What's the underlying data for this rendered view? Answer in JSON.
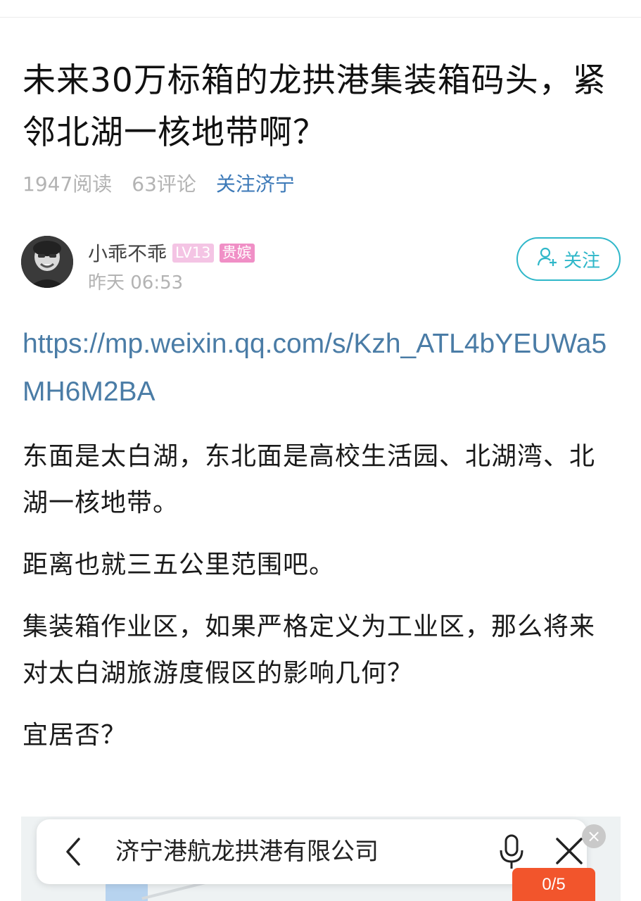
{
  "post": {
    "title": "未来30万标箱的龙拱港集装箱码头，紧邻北湖一核地带啊？",
    "reads": "1947阅读",
    "comments": "63评论",
    "follow_topic": "关注济宁"
  },
  "author": {
    "name": "小乖不乖",
    "level": "LV13",
    "rank": "贵嫔",
    "time": "昨天 06:53",
    "follow_label": "关注"
  },
  "content": {
    "link": "https://mp.weixin.qq.com/s/Kzh_ATL4bYEUWa5MH6M2BA",
    "paragraphs": [
      "东面是太白湖，东北面是高校生活园、北湖湾、北湖一核地带。",
      "距离也就三五公里范围吧。",
      "集装箱作业区，如果严格定义为工业区，那么将来对太白湖旅游度假区的影响几何？",
      "宜居否？"
    ]
  },
  "search_overlay": {
    "query": "济宁港航龙拱港有限公司",
    "counter": "0/5"
  },
  "icons": {
    "follow": "add-user-icon",
    "back": "chevron-left-icon",
    "mic": "microphone-icon",
    "close": "close-icon",
    "clear": "clear-icon"
  },
  "colors": {
    "link": "#4a7ca6",
    "follow_accent": "#2fb7c9",
    "counter_bg": "#f2552c",
    "level_badge": "#f4c4e4",
    "rank_badge": "#f08fc6"
  }
}
